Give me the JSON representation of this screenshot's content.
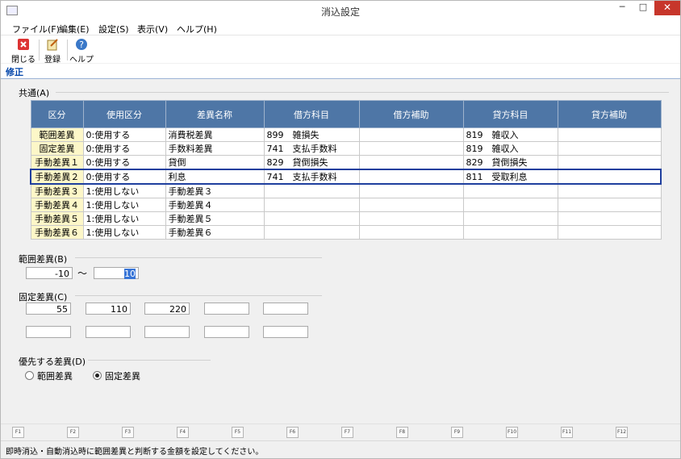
{
  "window": {
    "title": "消込設定",
    "minimize": "─",
    "maximize": "□",
    "close": "✕"
  },
  "menu": [
    "ファイル(F)",
    "編集(E)",
    "設定(S)",
    "表示(V)",
    "ヘルプ(H)"
  ],
  "toolbar": {
    "close_label": "閉じる",
    "register_label": "登録",
    "help_label": "ヘルプ"
  },
  "tab": {
    "label": "修正"
  },
  "common": {
    "label": "共通(A)",
    "headers": [
      "区分",
      "使用区分",
      "差異名称",
      "借方科目",
      "借方補助",
      "貸方科目",
      "貸方補助"
    ],
    "rows": [
      [
        "範囲差異",
        "0:使用する",
        "消費税差異",
        "899　雑損失",
        "",
        "819　雑収入",
        ""
      ],
      [
        "固定差異",
        "0:使用する",
        "手数料差異",
        "741　支払手数料",
        "",
        "819　雑収入",
        ""
      ],
      [
        "手動差異１",
        "0:使用する",
        "貸倒",
        "829　貸倒損失",
        "",
        "829　貸倒損失",
        ""
      ],
      [
        "手動差異２",
        "0:使用する",
        "利息",
        "741　支払手数料",
        "",
        "811　受取利息",
        ""
      ],
      [
        "手動差異３",
        "1:使用しない",
        "手動差異３",
        "",
        "",
        "",
        ""
      ],
      [
        "手動差異４",
        "1:使用しない",
        "手動差異４",
        "",
        "",
        "",
        ""
      ],
      [
        "手動差異５",
        "1:使用しない",
        "手動差異５",
        "",
        "",
        "",
        ""
      ],
      [
        "手動差異６",
        "1:使用しない",
        "手動差異６",
        "",
        "",
        "",
        ""
      ]
    ],
    "selected_row": 3
  },
  "range": {
    "label": "範囲差異(B)",
    "from": "-10",
    "tilde": "～",
    "to": "10"
  },
  "fixed": {
    "label": "固定差異(C)",
    "values": [
      "55",
      "110",
      "220",
      "",
      "",
      "",
      "",
      "",
      "",
      ""
    ]
  },
  "priority": {
    "label": "優先する差異(D)",
    "options": [
      "範囲差異",
      "固定差異"
    ],
    "selected": "固定差異"
  },
  "fkeys": [
    "F1",
    "F2",
    "F3",
    "F4",
    "F5",
    "F6",
    "F7",
    "F8",
    "F9",
    "F10",
    "F11",
    "F12"
  ],
  "status": {
    "text": "即時消込・自動消込時に範囲差異と判断する金額を設定してください。"
  },
  "colors": {
    "header_bg": "#4e76a6",
    "kubun_bg": "#fdf7c8",
    "selection_border": "#1f3f9e",
    "close_btn": "#c7362b"
  }
}
